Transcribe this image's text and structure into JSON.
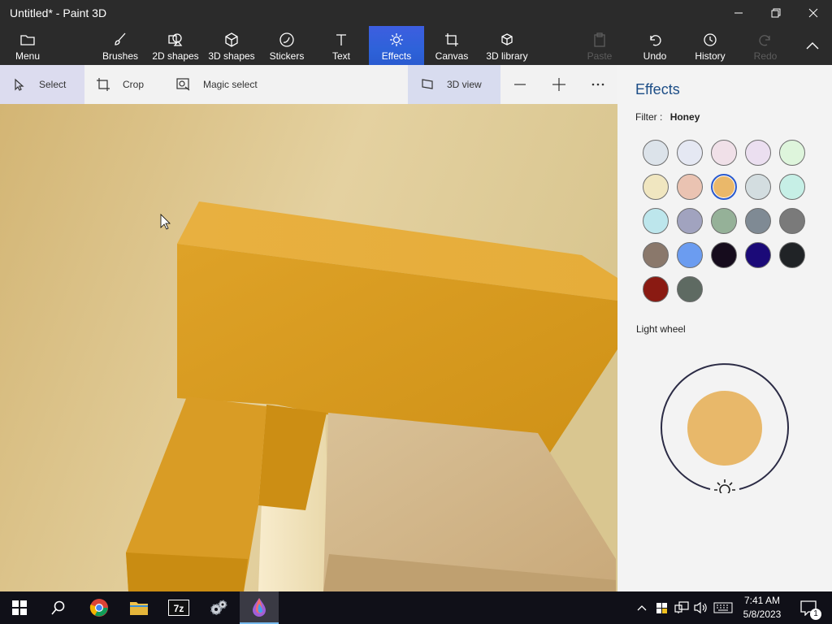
{
  "window": {
    "title": "Untitled* - Paint 3D"
  },
  "ribbon": {
    "menu": "Menu",
    "brushes": "Brushes",
    "shapes2d": "2D shapes",
    "shapes3d": "3D shapes",
    "stickers": "Stickers",
    "text": "Text",
    "effects": "Effects",
    "canvas": "Canvas",
    "library3d": "3D library",
    "paste": "Paste",
    "undo": "Undo",
    "history": "History",
    "redo": "Redo",
    "active_tab": "Effects"
  },
  "toolbar": {
    "select": "Select",
    "crop": "Crop",
    "magic_select": "Magic select",
    "view3d": "3D view"
  },
  "effects_panel": {
    "title": "Effects",
    "filter_label": "Filter :",
    "filter_value": "Honey",
    "light_wheel_label": "Light wheel",
    "light_color": "#e8b86a",
    "swatches": [
      "#dce3ea",
      "#e5e8f3",
      "#f0e0e8",
      "#ebdff0",
      "#def5dc",
      "#f0e6c0",
      "#eac3b2",
      "#eab86a",
      "#d3dde0",
      "#c6efe6",
      "#bde6ec",
      "#a1a3bf",
      "#95b198",
      "#7f8a94",
      "#7a7a7a",
      "#8a786b",
      "#6b9cf0",
      "#160c1d",
      "#1b0a78",
      "#202326",
      "#8a1a12",
      "#5e6a62"
    ],
    "selected_swatch": 7
  },
  "taskbar": {
    "time": "7:41 AM",
    "date": "5/8/2023",
    "notification_count": "1"
  }
}
